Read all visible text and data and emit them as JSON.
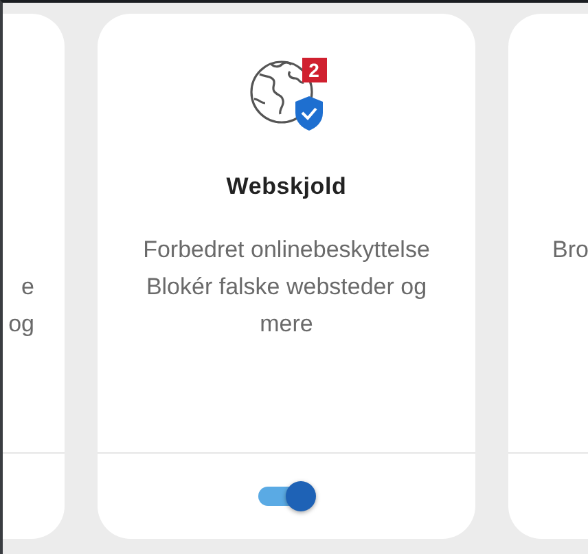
{
  "cards": [
    {
      "description_lines": [
        "e",
        "og"
      ]
    },
    {
      "badge": "2",
      "title": "Webskjold",
      "description_lines": [
        "Forbedret onlinebeskyttelse",
        "Blokér falske websteder og",
        "mere"
      ],
      "toggle": {
        "on": true
      }
    },
    {
      "description_lines": [
        "Bro"
      ]
    }
  ]
}
